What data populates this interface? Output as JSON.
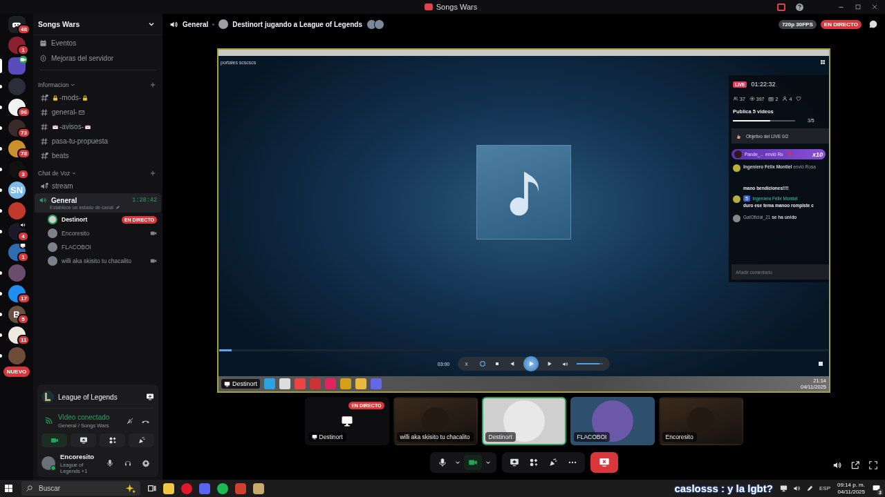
{
  "title_bar": {
    "title": "Songs Wars"
  },
  "servers": [
    {
      "kind": "home",
      "badge": "48",
      "selected": false,
      "unread": false
    },
    {
      "kind": "image",
      "badge": "1",
      "selected": false,
      "unread": false
    },
    {
      "kind": "image",
      "activity": {
        "kind": "video"
      },
      "selected": true,
      "unread": false
    },
    {
      "kind": "image",
      "selected": false,
      "unread": true
    },
    {
      "kind": "image",
      "badge": "96",
      "selected": false,
      "unread": true
    },
    {
      "kind": "image",
      "badge": "73",
      "selected": false,
      "unread": true
    },
    {
      "kind": "image",
      "badge": "78",
      "selected": false,
      "unread": true
    },
    {
      "kind": "image",
      "badge": "3",
      "selected": false,
      "unread": true
    },
    {
      "kind": "logo",
      "label": "SN",
      "selected": false,
      "unread": true
    },
    {
      "kind": "image",
      "selected": false,
      "unread": true
    },
    {
      "kind": "image",
      "badge": "4",
      "activity": {
        "kind": "voice"
      },
      "selected": false,
      "unread": true
    },
    {
      "kind": "image",
      "badge": "1",
      "activity": {
        "kind": "screen"
      },
      "selected": false,
      "unread": false
    },
    {
      "kind": "image",
      "selected": false,
      "unread": true
    },
    {
      "kind": "image",
      "badge": "17",
      "selected": false,
      "unread": true
    },
    {
      "kind": "logo",
      "label": "B",
      "badge": "5",
      "selected": false,
      "unread": true
    },
    {
      "kind": "image",
      "badge": "11",
      "selected": false,
      "unread": true
    },
    {
      "kind": "image",
      "selected": false,
      "unread": true
    }
  ],
  "new_badge": "NUEVO",
  "channel_sidebar": {
    "server_name": "Songs Wars",
    "links": [
      {
        "label": "Eventos",
        "kind": "events"
      },
      {
        "label": "Mejoras del servidor",
        "kind": "boosts"
      }
    ],
    "categories": [
      {
        "name": "Informacion",
        "channels": [
          {
            "name": "-mods-",
            "kind": "text",
            "private": true,
            "emoji_before": {
              "kind": "lock"
            },
            "emoji_after": {
              "kind": "lock"
            },
            "selected": false
          },
          {
            "name": "general-",
            "kind": "text",
            "private": false,
            "emoji_after": {
              "kind": "envelope"
            },
            "selected": false
          },
          {
            "name": "-avisos-",
            "kind": "text",
            "private": false,
            "emoji_before": {
              "kind": "mail"
            },
            "emoji_after": {
              "kind": "mail"
            },
            "selected": false
          },
          {
            "name": "pasa-tu-propuesta",
            "kind": "text",
            "private": false,
            "selected": false
          },
          {
            "name": "beats",
            "kind": "text",
            "private": true,
            "selected": false
          }
        ]
      },
      {
        "name": "Chat de Voz",
        "channels": [
          {
            "name": "stream",
            "kind": "voice",
            "private": true,
            "selected": false
          },
          {
            "name": "General",
            "kind": "voice",
            "private": false,
            "selected": true,
            "timer": "1:28:42",
            "status": "Establece un estado de canal",
            "members": [
              {
                "name": "Destinort",
                "speaking": true,
                "live": "EN DIRECTO",
                "camera": false
              },
              {
                "name": "Encoresito",
                "speaking": false,
                "camera": true
              },
              {
                "name": "FLACOBOI",
                "speaking": false,
                "camera": false
              },
              {
                "name": "willi aka skisito tu chacalito",
                "speaking": false,
                "camera": true
              }
            ]
          }
        ]
      }
    ]
  },
  "voice_panel": {
    "activity": "League of Legends",
    "status": "Video conectado",
    "location": "General / Songs Wars",
    "controls": [
      {
        "kind": "camera",
        "on": true
      },
      {
        "kind": "screen",
        "on": false
      },
      {
        "kind": "activities",
        "on": false
      },
      {
        "kind": "soundboard",
        "on": false
      }
    ]
  },
  "user_panel": {
    "name": "Encoresito",
    "status": "League of Legends +1"
  },
  "header": {
    "channel": "General",
    "stream_title": "Destinort jugando a League of Legends",
    "quality": "720p 30FPS",
    "live": "EN DIRECTO"
  },
  "stream": {
    "window_title": "portales scscscs",
    "live_panel": {
      "live_tag": "LIVE",
      "duration": "01:22:32",
      "stats": [
        {
          "kind": "viewers",
          "value": "37"
        },
        {
          "kind": "views",
          "value": "397"
        },
        {
          "kind": "gifts",
          "value": "2"
        },
        {
          "kind": "followers",
          "value": "4"
        },
        {
          "kind": "likes"
        }
      ],
      "task": {
        "title": "Publica 5 videos",
        "progress": {
          "level": 0.6
        },
        "count": "3/5"
      },
      "goal": {
        "label": "Objetivo del LIVE 0/2"
      },
      "gift": {
        "user": "Pande_..",
        "text": "envió Ro",
        "count": "x10"
      },
      "messages": [
        {
          "kind": "gift",
          "user": "Ingeniero Félix Montiel",
          "text": "envió Rosa"
        },
        {
          "kind": "continued",
          "text": "mano bendiciones!!!!"
        },
        {
          "kind": "chat",
          "user": "Ingeniero Félix Montiel",
          "badge": "5",
          "text": "duro ese tema manoo rompiste c"
        },
        {
          "kind": "join",
          "user": "GatOficial_21",
          "text": "se ha unido"
        }
      ],
      "comment_placeholder": "Añadir comentario"
    },
    "player": {
      "time": "03:00",
      "progress": {
        "level": 0.02
      },
      "volume": {
        "level": 0.85
      }
    },
    "inner_taskbar": {
      "user": "Destinort",
      "time": "21:14",
      "date": "04/11/2025"
    }
  },
  "tiles": [
    {
      "name": "Destinort",
      "kind": "screen",
      "live": "EN DIRECTO",
      "speaking": false
    },
    {
      "name": "willi aka skisito tu chacalito",
      "kind": "video",
      "speaking": false
    },
    {
      "name": "Destinort",
      "kind": "avatar",
      "speaking": true
    },
    {
      "name": "FLACOBOI",
      "kind": "avatar",
      "speaking": false
    },
    {
      "name": "Encoresito",
      "kind": "video",
      "speaking": false
    }
  ],
  "call_controls": [
    {
      "kind": "mic",
      "on": false
    },
    {
      "kind": "camera",
      "on": true
    },
    {
      "kind": "screen",
      "on": false
    },
    {
      "kind": "activities",
      "on": false
    },
    {
      "kind": "soundboard",
      "on": false
    },
    {
      "kind": "more",
      "on": false
    },
    {
      "kind": "stop-stream",
      "on": false
    }
  ],
  "taskbar": {
    "search_placeholder": "Buscar",
    "overlay_text": "caslosss : y la lgbt?",
    "language": "ESP",
    "time": "09:14 p. m.",
    "date": "04/11/2025",
    "notifications": "3"
  }
}
